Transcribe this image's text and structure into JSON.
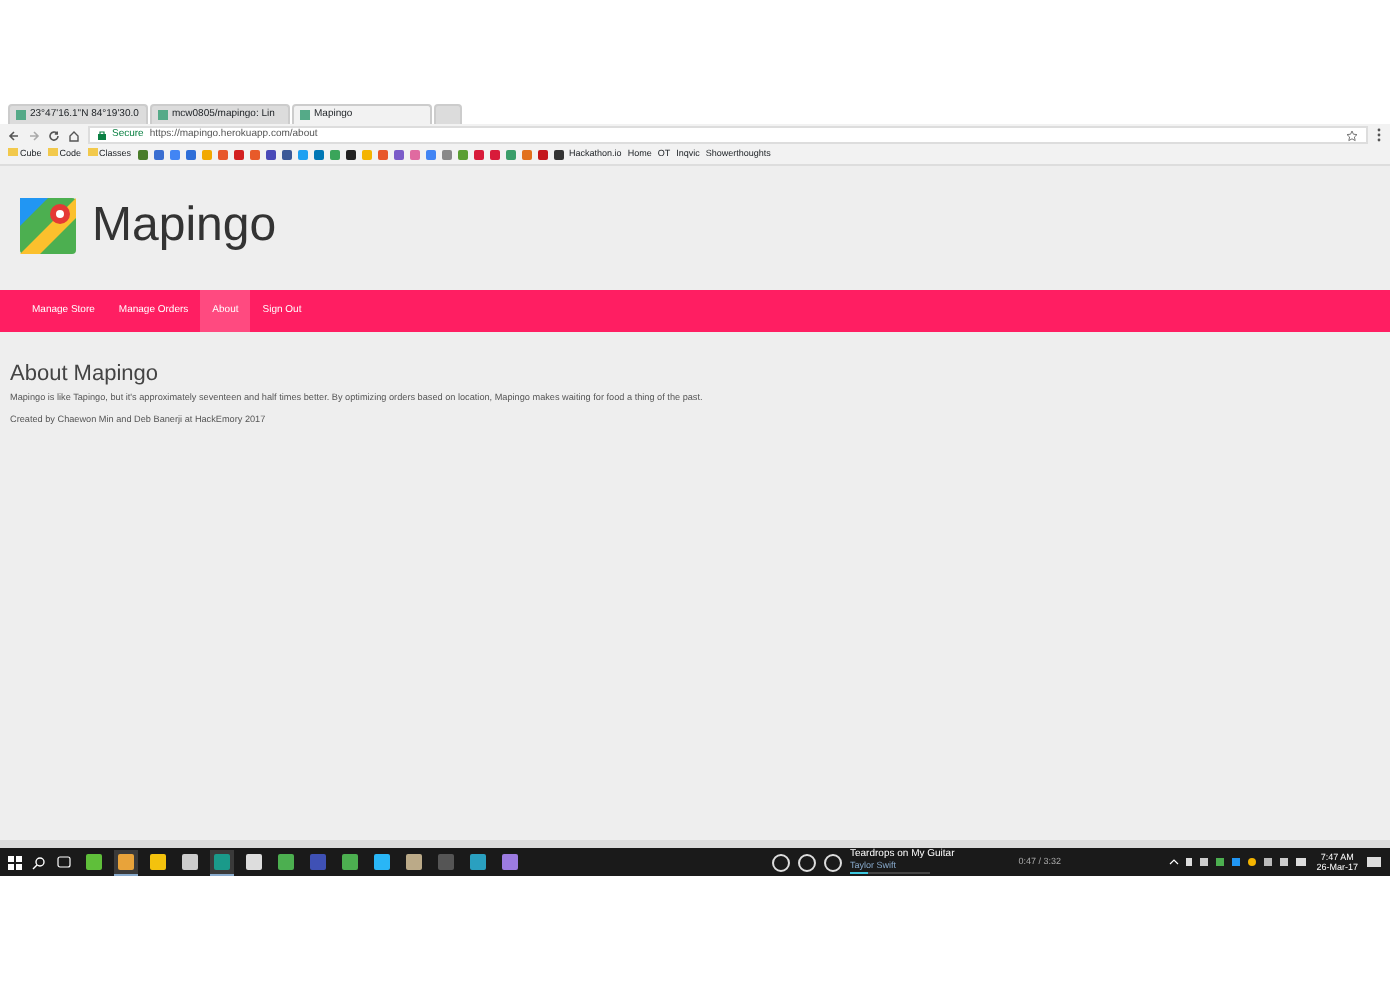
{
  "browser": {
    "tabs": [
      {
        "title": "23°47'16.1\"N 84°19'30.0",
        "selected": false
      },
      {
        "title": "mcw0805/mapingo: Lin",
        "selected": false
      },
      {
        "title": "Mapingo",
        "selected": true
      }
    ],
    "secure_label": "Secure",
    "url": "https://mapingo.herokuapp.com/about",
    "bookmarks": [
      {
        "label": "Cube",
        "kind": "folder"
      },
      {
        "label": "Code",
        "kind": "folder"
      },
      {
        "label": "Classes",
        "kind": "folder"
      },
      {
        "kind": "icon",
        "color": "#4a7d2a"
      },
      {
        "kind": "icon",
        "color": "#3b6fd1"
      },
      {
        "kind": "icon",
        "color": "#4285f4"
      },
      {
        "kind": "icon",
        "color": "#2f6fd8"
      },
      {
        "kind": "icon",
        "color": "#f2a900"
      },
      {
        "kind": "icon",
        "color": "#e8562a"
      },
      {
        "kind": "icon",
        "color": "#d32020"
      },
      {
        "kind": "icon",
        "color": "#e85a2a"
      },
      {
        "kind": "icon",
        "color": "#4a4ab8"
      },
      {
        "kind": "icon",
        "color": "#3b5998"
      },
      {
        "kind": "icon",
        "color": "#1da1f2"
      },
      {
        "kind": "icon",
        "color": "#0077b5"
      },
      {
        "kind": "icon",
        "color": "#3aa55a"
      },
      {
        "kind": "icon",
        "color": "#222222"
      },
      {
        "kind": "icon",
        "color": "#f4b400"
      },
      {
        "kind": "icon",
        "color": "#e8562a"
      },
      {
        "kind": "icon",
        "color": "#7b5cc9"
      },
      {
        "kind": "icon",
        "color": "#e06aa0"
      },
      {
        "kind": "icon",
        "color": "#4285f4"
      },
      {
        "kind": "icon",
        "color": "#888888"
      },
      {
        "kind": "icon",
        "color": "#5a9e32"
      },
      {
        "kind": "icon",
        "color": "#d81b3a"
      },
      {
        "kind": "icon",
        "color": "#d81b3a"
      },
      {
        "kind": "icon",
        "color": "#3a9e6a"
      },
      {
        "kind": "icon",
        "color": "#e2711d"
      },
      {
        "kind": "icon",
        "color": "#c4161c"
      },
      {
        "kind": "icon",
        "color": "#333333"
      },
      {
        "label": "Hackathon.io",
        "kind": "link"
      },
      {
        "label": "Home",
        "kind": "link"
      },
      {
        "label": "OT",
        "kind": "link"
      },
      {
        "label": "Inqvic",
        "kind": "link"
      },
      {
        "label": "Showerthoughts",
        "kind": "link"
      }
    ]
  },
  "site": {
    "brand": "Mapingo",
    "nav": [
      {
        "label": "Manage Store",
        "selected": false
      },
      {
        "label": "Manage Orders",
        "selected": false
      },
      {
        "label": "About",
        "selected": true
      },
      {
        "label": "Sign Out",
        "selected": false
      }
    ],
    "heading": "About Mapingo",
    "paragraphs": [
      "Mapingo is like Tapingo, but it's approximately seventeen and half times better. By optimizing orders based on location, Mapingo makes waiting for food a thing of the past.",
      "Created by Chaewon Min and Deb Banerji at HackEmory 2017"
    ]
  },
  "taskbar": {
    "apps": [
      {
        "color": "#5fbf3a",
        "selected": false
      },
      {
        "color": "#e8a33a",
        "selected": true
      },
      {
        "color": "#f4c20d",
        "selected": false
      },
      {
        "color": "#cccccc",
        "selected": false
      },
      {
        "color": "#1a9a8a",
        "selected": true
      },
      {
        "color": "#dddddd",
        "selected": false
      },
      {
        "color": "#4caf50",
        "selected": false
      },
      {
        "color": "#3f51b5",
        "selected": false
      },
      {
        "color": "#4caf50",
        "selected": false
      },
      {
        "color": "#29b6f6",
        "selected": false
      },
      {
        "color": "#bbaa88",
        "selected": false
      },
      {
        "color": "#555555",
        "selected": false
      },
      {
        "color": "#2aa0c0",
        "selected": false
      },
      {
        "color": "#9c7be0",
        "selected": false
      }
    ],
    "song": "Teardrops on My Guitar",
    "level": 0.22,
    "artist": "Taylor Swift",
    "progress": "0:47 / 3:32",
    "time": "7:47 AM",
    "date": "26-Mar-17"
  }
}
